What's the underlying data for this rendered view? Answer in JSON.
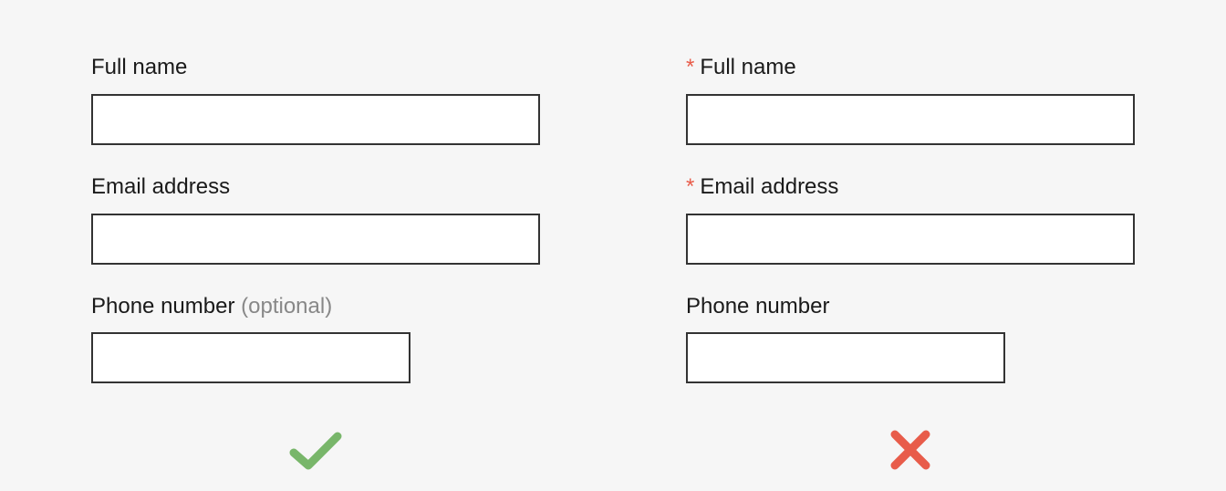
{
  "left": {
    "fields": [
      {
        "label": "Full name",
        "optional": "",
        "value": ""
      },
      {
        "label": "Email address",
        "optional": "",
        "value": ""
      },
      {
        "label": "Phone number",
        "optional": "(optional)",
        "value": ""
      }
    ]
  },
  "right": {
    "required_marker": "*",
    "fields": [
      {
        "label": "Full name",
        "required": true,
        "value": ""
      },
      {
        "label": "Email address",
        "required": true,
        "value": ""
      },
      {
        "label": "Phone number",
        "required": false,
        "value": ""
      }
    ]
  },
  "colors": {
    "asterisk": "#e85c4a",
    "check": "#78b66a",
    "cross": "#e85c4a"
  }
}
